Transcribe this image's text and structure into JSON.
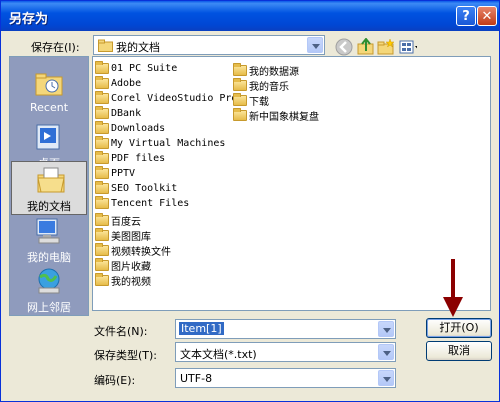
{
  "window": {
    "title": "另存为"
  },
  "save_in": {
    "label": "保存在(I):",
    "value": "我的文档"
  },
  "places": [
    {
      "label": "Recent"
    },
    {
      "label": "桌面"
    },
    {
      "label": "我的文档"
    },
    {
      "label": "我的电脑"
    },
    {
      "label": "网上邻居"
    }
  ],
  "files_col1": [
    "01 PC Suite",
    "Adobe",
    "Corel VideoStudio Pro",
    "DBank",
    "Downloads",
    "My Virtual Machines",
    "PDF files",
    "PPTV",
    "SEO Toolkit",
    "Tencent Files",
    "百度云",
    "美图图库",
    "视频转换文件",
    "图片收藏",
    "我的视频"
  ],
  "files_col2": [
    "我的数据源",
    "我的音乐",
    "下载",
    "新中国象棋复盘"
  ],
  "filename": {
    "label": "文件名(N):",
    "value": "Item[1]"
  },
  "filetype": {
    "label": "保存类型(T):",
    "value": "文本文档(*.txt)"
  },
  "encoding": {
    "label": "编码(E):",
    "value": "UTF-8"
  },
  "buttons": {
    "open": "打开(O)",
    "cancel": "取消"
  },
  "colors": {
    "title_bar": "#0053e1",
    "places_bg": "#8f9bbd",
    "dialog_bg": "#ece9d8",
    "arrow": "#8b0000"
  }
}
